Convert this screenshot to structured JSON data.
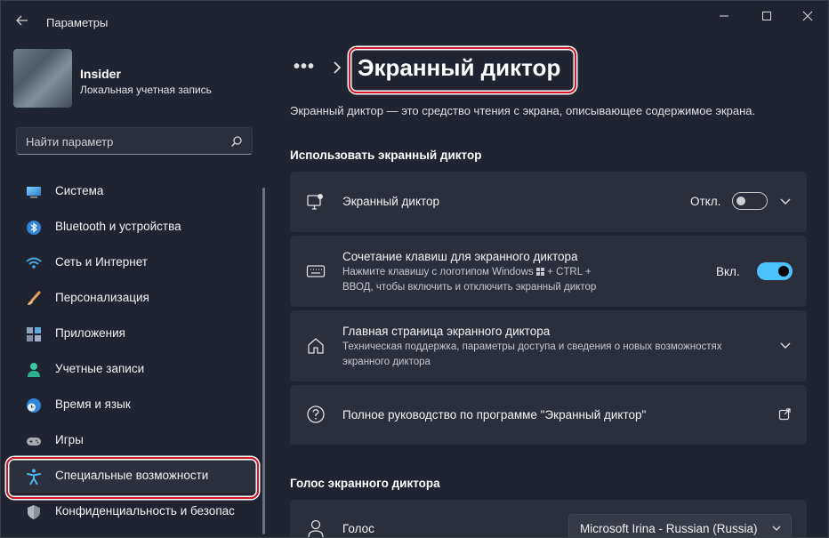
{
  "window": {
    "title": "Параметры",
    "minimize_icon": "minimize-icon",
    "maximize_icon": "maximize-icon",
    "close_icon": "close-icon"
  },
  "user": {
    "name": "Insider",
    "account_type": "Локальная учетная запись"
  },
  "search": {
    "placeholder": "Найти параметр"
  },
  "sidebar": {
    "items": [
      {
        "label": "Система",
        "icon": "display-icon"
      },
      {
        "label": "Bluetooth и устройства",
        "icon": "bluetooth-icon"
      },
      {
        "label": "Сеть и Интернет",
        "icon": "wifi-icon"
      },
      {
        "label": "Персонализация",
        "icon": "brush-icon"
      },
      {
        "label": "Приложения",
        "icon": "apps-icon"
      },
      {
        "label": "Учетные записи",
        "icon": "person-icon"
      },
      {
        "label": "Время и язык",
        "icon": "globe-clock-icon"
      },
      {
        "label": "Игры",
        "icon": "gamepad-icon"
      },
      {
        "label": "Специальные возможности",
        "icon": "accessibility-icon",
        "selected": true
      },
      {
        "label": "Конфиденциальность и безопас",
        "icon": "shield-icon"
      }
    ]
  },
  "header": {
    "breadcrumb_more": "•••",
    "title": "Экранный диктор",
    "description": "Экранный диктор — это средство чтения с экрана, описывающее содержимое экрана."
  },
  "sections": {
    "use_narrator": "Использовать экранный диктор",
    "narrator_voice": "Голос экранного диктора"
  },
  "cards": {
    "narrator": {
      "title": "Экранный диктор",
      "state": "Откл.",
      "on": false
    },
    "shortcut": {
      "title": "Сочетание клавиш для экранного диктора",
      "sub_line1": "Нажмите клавишу с логотипом Windows",
      "sub_line1_end": "+ CTRL +",
      "sub_line2": "ВВОД, чтобы включить и отключить экранный диктор",
      "state": "Вкл.",
      "on": true
    },
    "home": {
      "title": "Главная страница экранного диктора",
      "sub_line1": "Техническая поддержка, параметры доступа и сведения о новых возможностях",
      "sub_line2": "экранного диктора"
    },
    "guide": {
      "title": "Полное руководство по программе \"Экранный диктор\""
    },
    "voice": {
      "title": "Голос",
      "value": "Microsoft Irina - Russian (Russia)"
    }
  },
  "colors": {
    "accent": "#4cc2ff",
    "highlight": "#cf1b2b",
    "card": "#2b2f3b",
    "background": "#202431"
  }
}
